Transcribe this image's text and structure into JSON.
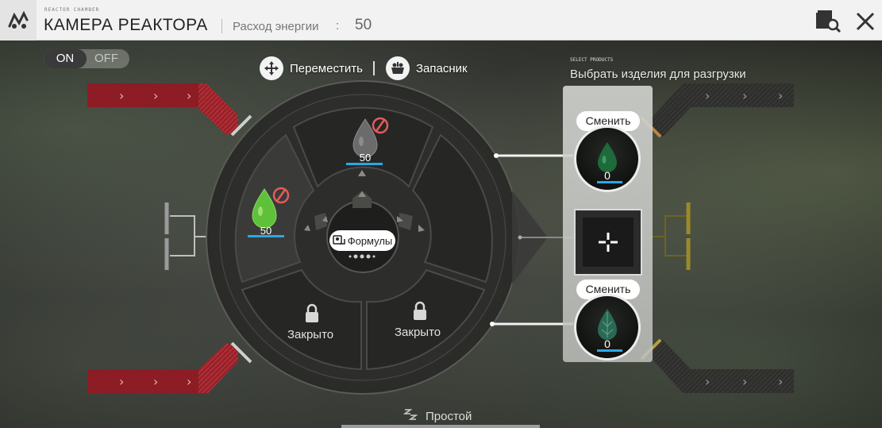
{
  "header": {
    "subtitle": "REACTOR CHAMBER",
    "title": "КАМЕРА РЕАКТОРА",
    "energy_label": "Расход энергии",
    "energy_colon": ":",
    "energy_value": "50"
  },
  "toggle": {
    "on_label": "ON",
    "off_label": "OFF",
    "state": "on"
  },
  "toolbar": {
    "move_label": "Переместить",
    "separator": "|",
    "spare_label": "Запасник"
  },
  "unload": {
    "caption": "SELECT PRODUCTS",
    "title": "Выбрать изделия для разгрузки"
  },
  "wheel": {
    "top_slot": {
      "value": "50",
      "color": "#6b6b6b"
    },
    "left_slot": {
      "value": "50",
      "color": "#5fc03a"
    },
    "bottom_left_label": "Закрыто",
    "bottom_right_label": "Закрыто",
    "formulas_label": "Формулы"
  },
  "outputs": [
    {
      "swap_label": "Сменить",
      "value": "0",
      "color": "#2e9a5a"
    },
    {
      "swap_label": "Сменить",
      "value": "0",
      "color": "#4aa080"
    }
  ],
  "status": {
    "label": "Простой"
  },
  "colors": {
    "accent_red": "#c8323a",
    "bar_blue": "#2aa8e6",
    "no_icon": "#e65a5a"
  },
  "icons": [
    "logo-icon",
    "search-document-icon",
    "close-icon",
    "move-icon",
    "spare-icon",
    "lock-icon",
    "plus-icon",
    "status-icon",
    "formula-icon"
  ]
}
